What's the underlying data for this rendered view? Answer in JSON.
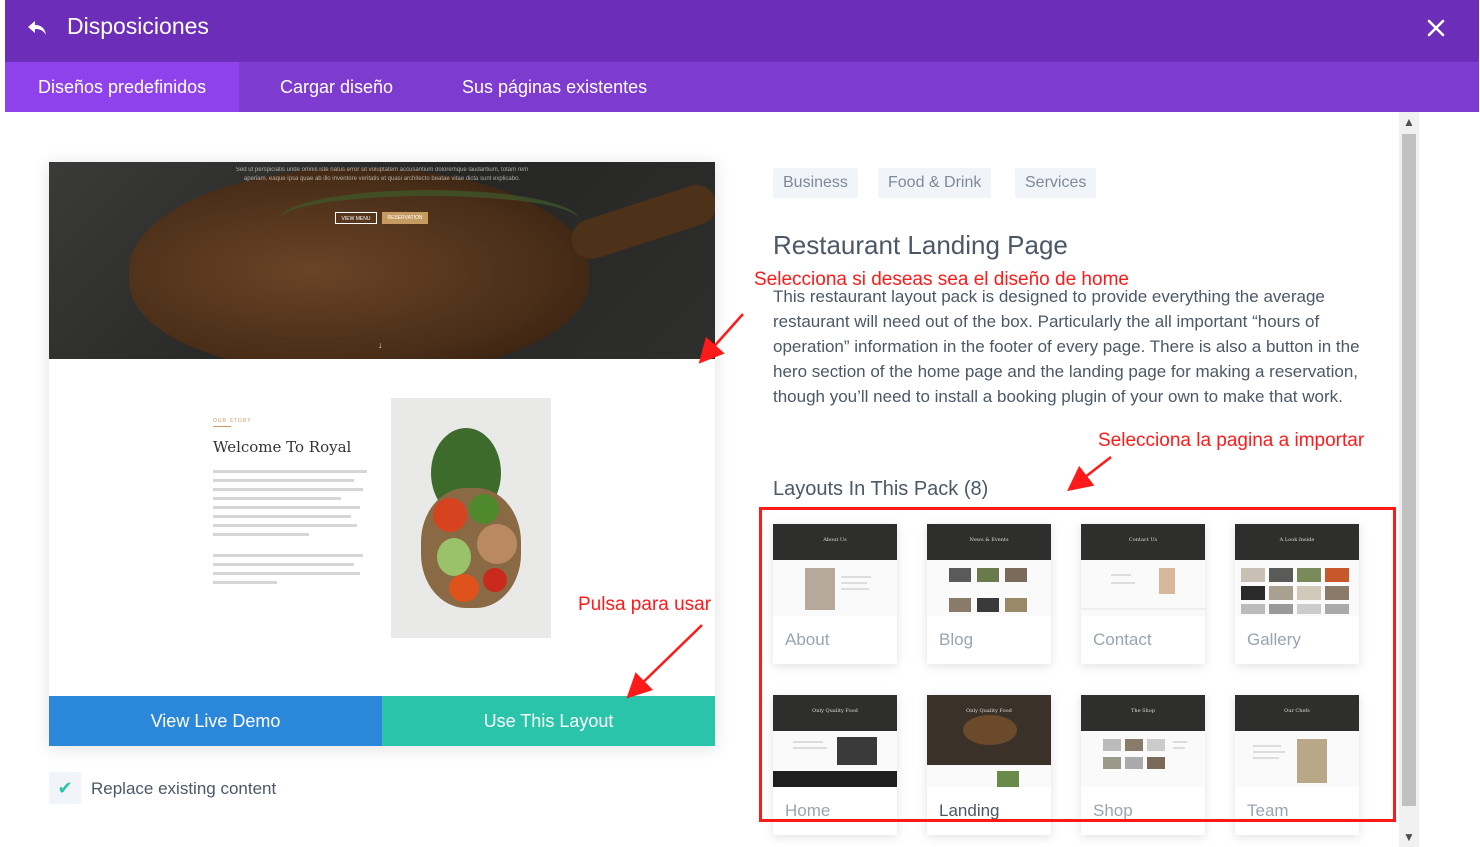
{
  "window": {
    "title": "Disposiciones"
  },
  "tabs": [
    {
      "label": "Diseños predefinidos",
      "active": true
    },
    {
      "label": "Cargar diseño",
      "active": false
    },
    {
      "label": "Sus páginas existentes",
      "active": false
    }
  ],
  "preview": {
    "hero_text": "Sed ut perspiciatis unde omnis iste natus error sit voluptatem accusantium doloremque laudantium, totam rem aperiam, eaque ipsa quae ab illo inventore veritatis et quasi architecto beatae vitae dicta sunt explicabo.",
    "hero_btn_view": "VIEW MENU",
    "hero_btn_reserve": "RESERVATION",
    "story_kicker": "OUR STORY",
    "story_title": "Welcome To Royal"
  },
  "actions": {
    "view_demo": "View Live Demo",
    "use_layout": "Use This Layout",
    "replace_label": "Replace existing content",
    "replace_checked": true
  },
  "tags": [
    "Business",
    "Food & Drink",
    "Services"
  ],
  "layout": {
    "title": "Restaurant Landing Page",
    "description": "This restaurant layout pack is designed to provide everything the average restaurant will need out of the box. Particularly the all important “hours of operation” information in the footer of every page. There is also a button in the hero section of the home page and the landing page for making a reservation, though you’ll need to install a booking plugin of your own to make that work."
  },
  "pack": {
    "title": "Layouts In This Pack (8)",
    "layouts": [
      {
        "label": "About",
        "thumb_title": "About Us"
      },
      {
        "label": "Blog",
        "thumb_title": "News & Events"
      },
      {
        "label": "Contact",
        "thumb_title": "Contact Us"
      },
      {
        "label": "Gallery",
        "thumb_title": "A Look Inside"
      },
      {
        "label": "Home",
        "thumb_title": "Only Quality Food"
      },
      {
        "label": "Landing",
        "thumb_title": "Only Quality Food"
      },
      {
        "label": "Shop",
        "thumb_title": "The Shop"
      },
      {
        "label": "Team",
        "thumb_title": "Our Chefs"
      }
    ]
  },
  "annotations": {
    "home": "Selecciona si deseas sea el diseño de home",
    "import": "Selecciona la pagina a importar",
    "use": "Pulsa para usar"
  },
  "colors": {
    "titlebar": "#6c2eb9",
    "tabbar": "#7e3bd0",
    "tab_active": "#8f42ec",
    "demo_button": "#2b87da",
    "use_button": "#29c4a9",
    "annotation": "#ff1a1a"
  },
  "icons": {
    "back": "undo-arrow-icon",
    "close": "close-icon",
    "check": "checkmark-icon"
  }
}
